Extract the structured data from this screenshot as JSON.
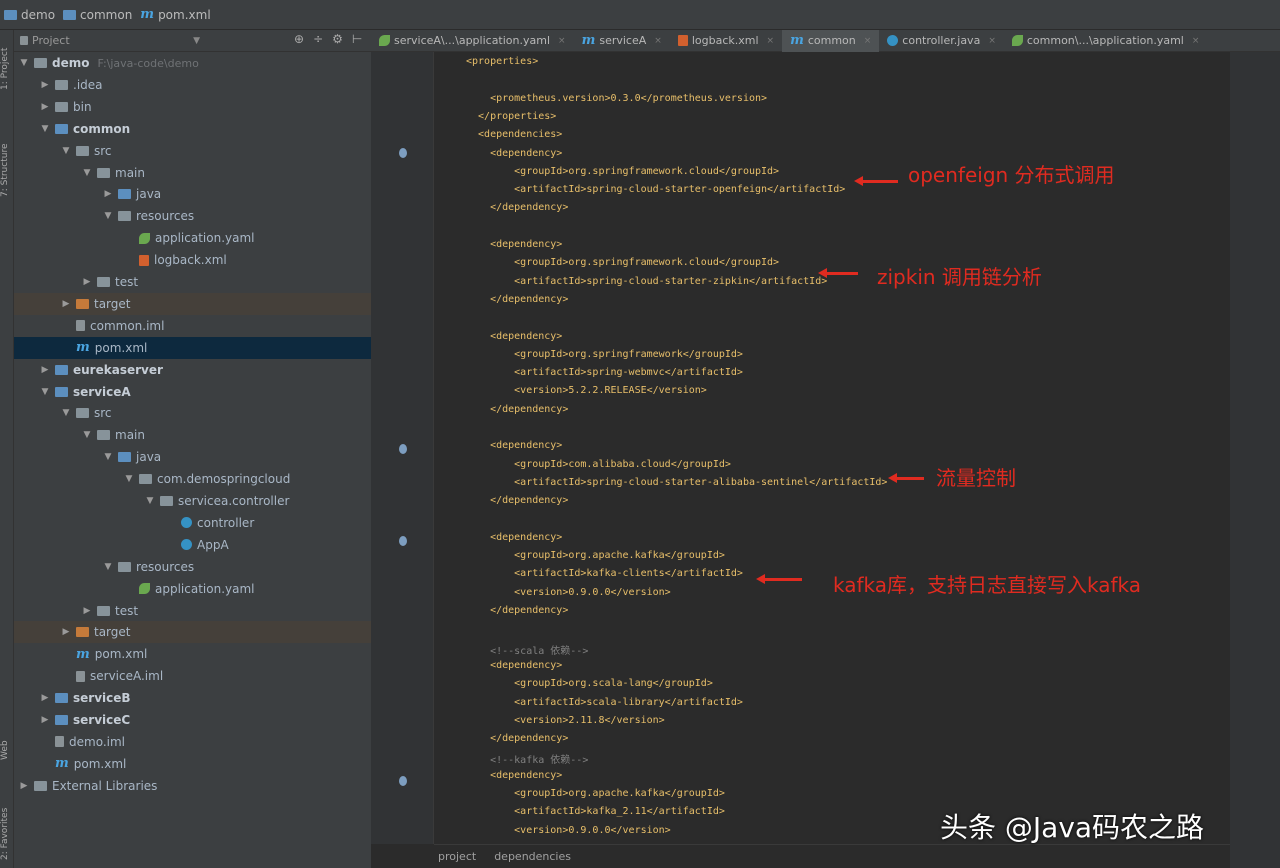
{
  "breadcrumb": [
    "demo",
    "common",
    "pom.xml"
  ],
  "project_panel": {
    "selector_label": "Project",
    "tools": [
      "⊕",
      "÷",
      "⚙",
      "⊢"
    ]
  },
  "tree": [
    {
      "label": "demo",
      "hint": "F:\\java-code\\demo",
      "bold": true,
      "arrow": "▼",
      "icon": "folder"
    },
    {
      "label": ".idea",
      "arrow": "▶",
      "icon": "folder"
    },
    {
      "label": "bin",
      "arrow": "▶",
      "icon": "folder"
    },
    {
      "label": "common",
      "bold": true,
      "arrow": "▼",
      "icon": "folder-blue"
    },
    {
      "label": "src",
      "arrow": "▼",
      "icon": "folder"
    },
    {
      "label": "main",
      "arrow": "▼",
      "icon": "folder"
    },
    {
      "label": "java",
      "arrow": "▶",
      "icon": "folder-blue"
    },
    {
      "label": "resources",
      "arrow": "▼",
      "icon": "folder"
    },
    {
      "label": "application.yaml",
      "arrow": "",
      "icon": "leaf"
    },
    {
      "label": "logback.xml",
      "arrow": "",
      "icon": "xml"
    },
    {
      "label": "test",
      "arrow": "▶",
      "icon": "folder"
    },
    {
      "label": "target",
      "arrow": "▶",
      "icon": "folder-orange"
    },
    {
      "label": "common.iml",
      "arrow": "",
      "icon": "file"
    },
    {
      "label": "pom.xml",
      "arrow": "",
      "icon": "m"
    },
    {
      "label": "eurekaserver",
      "bold": true,
      "arrow": "▶",
      "icon": "folder-blue"
    },
    {
      "label": "serviceA",
      "bold": true,
      "arrow": "▼",
      "icon": "folder-blue"
    },
    {
      "label": "src",
      "arrow": "▼",
      "icon": "folder"
    },
    {
      "label": "main",
      "arrow": "▼",
      "icon": "folder"
    },
    {
      "label": "java",
      "arrow": "▼",
      "icon": "folder-blue"
    },
    {
      "label": "com.demospringcloud",
      "arrow": "▼",
      "icon": "folder"
    },
    {
      "label": "servicea.controller",
      "arrow": "▼",
      "icon": "folder"
    },
    {
      "label": "controller",
      "arrow": "",
      "icon": "circle"
    },
    {
      "label": "AppA",
      "arrow": "",
      "icon": "circle"
    },
    {
      "label": "resources",
      "arrow": "▼",
      "icon": "folder"
    },
    {
      "label": "application.yaml",
      "arrow": "",
      "icon": "leaf"
    },
    {
      "label": "test",
      "arrow": "▶",
      "icon": "folder"
    },
    {
      "label": "target",
      "arrow": "▶",
      "icon": "folder-orange"
    },
    {
      "label": "pom.xml",
      "arrow": "",
      "icon": "m"
    },
    {
      "label": "serviceA.iml",
      "arrow": "",
      "icon": "file"
    },
    {
      "label": "serviceB",
      "bold": true,
      "arrow": "▶",
      "icon": "folder-blue"
    },
    {
      "label": "serviceC",
      "bold": true,
      "arrow": "▶",
      "icon": "folder-blue"
    },
    {
      "label": "demo.iml",
      "arrow": "",
      "icon": "file"
    },
    {
      "label": "pom.xml",
      "arrow": "",
      "icon": "m"
    },
    {
      "label": "External Libraries",
      "arrow": "▶",
      "icon": "folder"
    }
  ],
  "tabs": [
    {
      "label": "serviceA\\...\\application.yaml",
      "icon": "leaf"
    },
    {
      "label": "serviceA",
      "icon": "m"
    },
    {
      "label": "logback.xml",
      "icon": "xml"
    },
    {
      "label": "common",
      "icon": "m",
      "active": true
    },
    {
      "label": "controller.java",
      "icon": "circle"
    },
    {
      "label": "common\\...\\application.yaml",
      "icon": "leaf"
    }
  ],
  "code_lines": [
    {
      "text": "<properties>",
      "kind": "tag"
    },
    {
      "text": "",
      "kind": "tag"
    },
    {
      "text": "    <prometheus.version>0.3.0</prometheus.version>",
      "kind": "tag"
    },
    {
      "text": "  </properties>",
      "kind": "tag"
    },
    {
      "text": "  <dependencies>",
      "kind": "tag"
    },
    {
      "text": "    <dependency>",
      "kind": "tag"
    },
    {
      "text": "        <groupId>org.springframework.cloud</groupId>",
      "kind": "tag"
    },
    {
      "text": "        <artifactId>spring-cloud-starter-openfeign</artifactId>",
      "kind": "tag"
    },
    {
      "text": "    </dependency>",
      "kind": "tag"
    },
    {
      "text": "",
      "kind": "tag"
    },
    {
      "text": "    <dependency>",
      "kind": "tag"
    },
    {
      "text": "        <groupId>org.springframework.cloud</groupId>",
      "kind": "tag"
    },
    {
      "text": "        <artifactId>spring-cloud-starter-zipkin</artifactId>",
      "kind": "tag"
    },
    {
      "text": "    </dependency>",
      "kind": "tag"
    },
    {
      "text": "",
      "kind": "tag"
    },
    {
      "text": "    <dependency>",
      "kind": "tag"
    },
    {
      "text": "        <groupId>org.springframework</groupId>",
      "kind": "tag"
    },
    {
      "text": "        <artifactId>spring-webmvc</artifactId>",
      "kind": "tag"
    },
    {
      "text": "        <version>5.2.2.RELEASE</version>",
      "kind": "tag"
    },
    {
      "text": "    </dependency>",
      "kind": "tag"
    },
    {
      "text": "",
      "kind": "tag"
    },
    {
      "text": "    <dependency>",
      "kind": "tag"
    },
    {
      "text": "        <groupId>com.alibaba.cloud</groupId>",
      "kind": "tag"
    },
    {
      "text": "        <artifactId>spring-cloud-starter-alibaba-sentinel</artifactId>",
      "kind": "tag"
    },
    {
      "text": "    </dependency>",
      "kind": "tag"
    },
    {
      "text": "",
      "kind": "tag"
    },
    {
      "text": "    <dependency>",
      "kind": "tag"
    },
    {
      "text": "        <groupId>org.apache.kafka</groupId>",
      "kind": "tag"
    },
    {
      "text": "        <artifactId>kafka-clients</artifactId>",
      "kind": "tag"
    },
    {
      "text": "        <version>0.9.0.0</version>",
      "kind": "tag"
    },
    {
      "text": "    </dependency>",
      "kind": "tag"
    },
    {
      "text": "",
      "kind": "tag"
    },
    {
      "text": "    <!--scala 依赖-->",
      "kind": "cmt"
    },
    {
      "text": "    <dependency>",
      "kind": "tag"
    },
    {
      "text": "        <groupId>org.scala-lang</groupId>",
      "kind": "tag"
    },
    {
      "text": "        <artifactId>scala-library</artifactId>",
      "kind": "tag"
    },
    {
      "text": "        <version>2.11.8</version>",
      "kind": "tag"
    },
    {
      "text": "    </dependency>",
      "kind": "tag"
    },
    {
      "text": "    <!--kafka 依赖-->",
      "kind": "cmt"
    },
    {
      "text": "    <dependency>",
      "kind": "tag"
    },
    {
      "text": "        <groupId>org.apache.kafka</groupId>",
      "kind": "tag"
    },
    {
      "text": "        <artifactId>kafka_2.11</artifactId>",
      "kind": "tag"
    },
    {
      "text": "        <version>0.9.0.0</version>",
      "kind": "tag"
    }
  ],
  "annotations": {
    "openfeign": "openfeign 分布式调用",
    "zipkin": "zipkin 调用链分析",
    "sentinel": "流量控制",
    "kafka": "kafka库，支持日志直接写入kafka"
  },
  "bottom_tabs": [
    "project",
    "dependencies"
  ],
  "watermark": "头条 @Java码农之路",
  "side_tabs": {
    "project": "1: Project",
    "structure": "7: Structure",
    "web": "Web",
    "favorites": "2: Favorites"
  }
}
